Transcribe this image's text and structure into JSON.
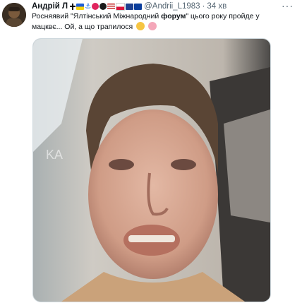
{
  "tweet": {
    "author_name": "Андрій Л",
    "handle": "@Andrii_L1983",
    "separator": "·",
    "time": "34 хв",
    "more_label": "···",
    "text_before": "Росняявий \"Ялтінський Міжнародний ",
    "text_bold": "форум",
    "text_after": "\" цього року пройде у мацквє... Ой, а що трапилося",
    "badge_icons": [
      "cross-icon",
      "ukraine-flag-icon",
      "anchor-icon",
      "red-heart-icon",
      "black-heart-icon",
      "usa-flag-icon",
      "poland-flag-icon",
      "uk-flag-icon",
      "eu-flag-icon"
    ],
    "emoji_icons": [
      "thinking-face-icon",
      "pig-face-icon"
    ],
    "media_watermark": "KA"
  }
}
